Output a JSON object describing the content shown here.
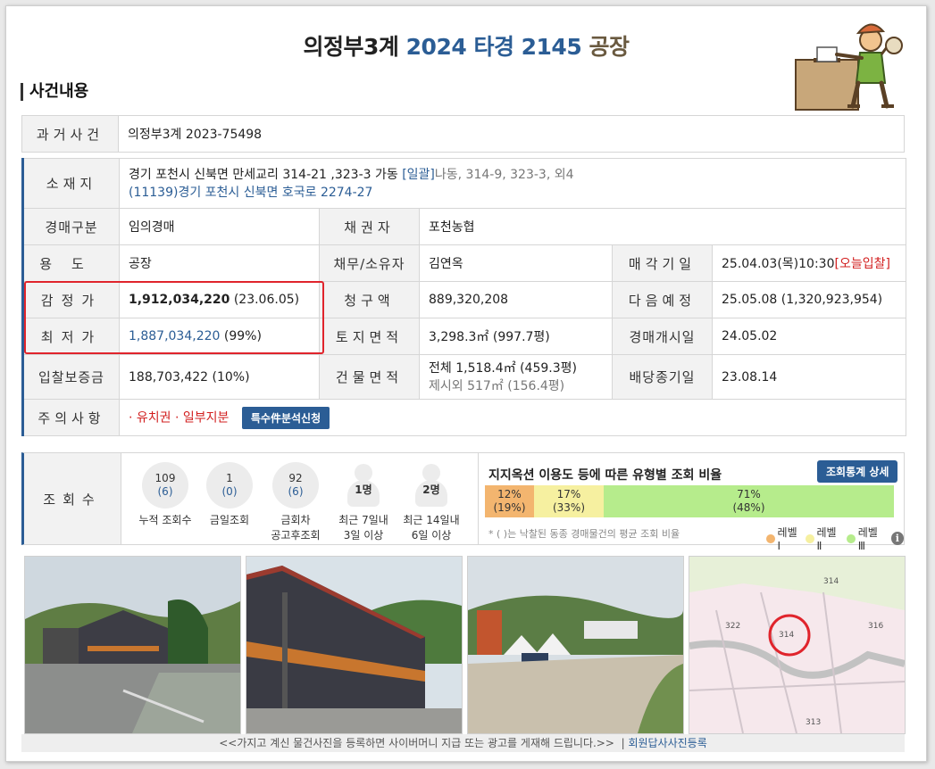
{
  "header": {
    "court": "의정부3계",
    "case_no": "2024 타경 2145",
    "category": "공장",
    "section_title": "사건내용"
  },
  "info": {
    "past_case": {
      "label": "과거사건",
      "value": "의정부3계 2023-75498"
    },
    "location": {
      "label": "소재지",
      "address": "경기 포천시 신북면 만세교리 314-21 ,323-3 가동",
      "bundle_tag": "[일괄]",
      "bundle_rest": "나동, 314-9, 323-3, 외4",
      "road_address": "(11139)경기 포천시 신북면 호국로 2274-27"
    },
    "auction_type": {
      "label": "경매구분",
      "value": "임의경매"
    },
    "creditor": {
      "label": "채권자",
      "value": "포천농협"
    },
    "usage": {
      "label": "용도",
      "value": "공장"
    },
    "debtor": {
      "label": "채무/소유자",
      "value": "김연옥"
    },
    "sale_date": {
      "label": "매각기일",
      "value": "25.04.03(목)10:30",
      "tag": "[오늘입찰]"
    },
    "appraisal": {
      "label": "감정가",
      "amount": "1,912,034,220",
      "date": "(23.06.05)"
    },
    "claim": {
      "label": "청구액",
      "value": "889,320,208"
    },
    "next_date": {
      "label": "다음예정",
      "value": "25.05.08 (1,320,923,954)"
    },
    "minimum": {
      "label": "최저가",
      "amount": "1,887,034,220",
      "pct": "(99%)"
    },
    "land_area": {
      "label": "토지면적",
      "value": "3,298.3㎡ (997.7평)"
    },
    "start_date": {
      "label": "경매개시일",
      "value": "24.05.02"
    },
    "deposit": {
      "label": "입찰보증금",
      "value": "188,703,422 (10%)"
    },
    "building_area": {
      "label": "건물면적",
      "line1": "전체 1,518.4㎡ (459.3평)",
      "line2": "제시외 517㎡ (156.4평)"
    },
    "dividend_end": {
      "label": "배당종기일",
      "value": "23.08.14"
    },
    "caution": {
      "label": "주의사항",
      "value": "· 유치권 · 일부지분",
      "button": "특수件분석신청"
    }
  },
  "views": {
    "label": "조회수",
    "stats": [
      {
        "top": "109",
        "sub": "(6)",
        "label1": "누적 조회수",
        "label2": ""
      },
      {
        "top": "1",
        "sub": "(0)",
        "label1": "금일조회",
        "label2": ""
      },
      {
        "top": "92",
        "sub": "(6)",
        "label1": "금회차",
        "label2": "공고후조회"
      }
    ],
    "persons": [
      {
        "count": "1명",
        "label1": "최근 7일내",
        "label2": "3일 이상"
      },
      {
        "count": "2명",
        "label1": "최근 14일내",
        "label2": "6일 이상"
      }
    ]
  },
  "ratio": {
    "title": "지지옥션 이용도 등에 따른 유형별 조회 비율",
    "button": "조회통계 상세",
    "bars": [
      {
        "pct": "12%",
        "avg": "(19%)",
        "value": 12,
        "color": "#f3b56f"
      },
      {
        "pct": "17%",
        "avg": "(33%)",
        "value": 17,
        "color": "#f6f0a0"
      },
      {
        "pct": "71%",
        "avg": "(48%)",
        "value": 71,
        "color": "#b6ec8c"
      }
    ],
    "note": "* ( )는 낙찰된 동종 경매물건의 평균 조회 비율",
    "legend": [
      {
        "label": "레벨Ⅰ",
        "color": "#f3b56f"
      },
      {
        "label": "레벨Ⅱ",
        "color": "#f6f0a0"
      },
      {
        "label": "레벨Ⅲ",
        "color": "#b6ec8c"
      }
    ],
    "info_icon": "i"
  },
  "footer": {
    "text": "<<가지고 계신 물건사진을 등록하면 사이버머니 지급 또는 광고를 게재해 드립니다.>>",
    "separator": "|",
    "link": "회원답사사진등록"
  }
}
